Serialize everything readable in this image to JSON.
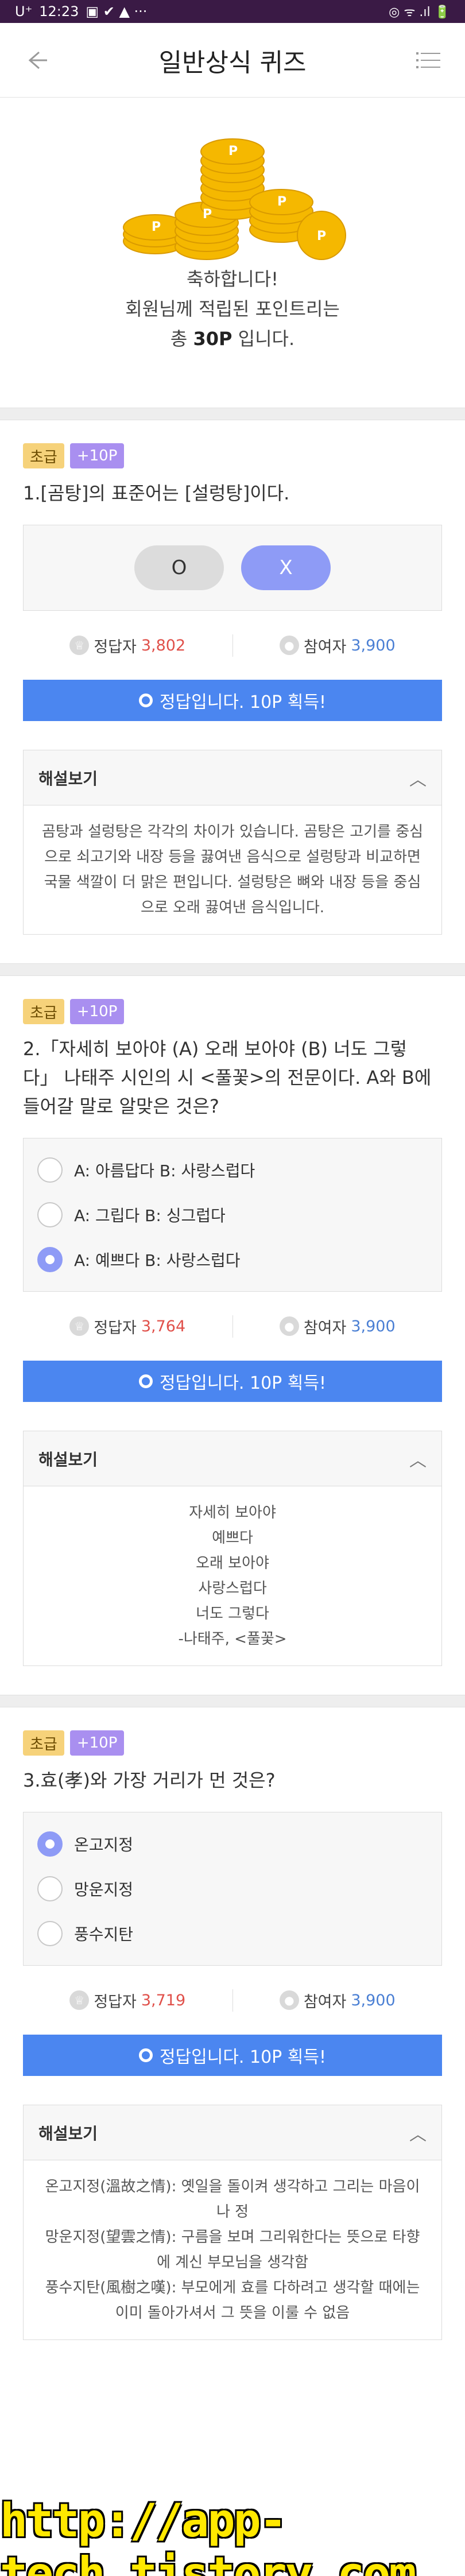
{
  "statusbar": {
    "carrier": "U⁺",
    "time": "12:23",
    "indicators": "▣ ✔ ▲ ···",
    "right": "◎ ᯤ .ıl 🔋"
  },
  "header": {
    "title": "일반상식 퀴즈",
    "back_icon": "arrow-left-icon",
    "menu_icon": "menu-icon"
  },
  "hero": {
    "line1": "축하합니다!",
    "line2": "회원님께 적립된 포인트리는",
    "line3_pre": "총 ",
    "line3_points": "30P",
    "line3_post": " 입니다."
  },
  "labels": {
    "correct": "정답자",
    "participants": "참여자",
    "explain": "해설보기",
    "result": "정답입니다. 10P 획득!"
  },
  "colors": {
    "accent": "#4b86f0",
    "selected": "#8e9bf6",
    "level_badge": "#f6d27a",
    "point_badge": "#a98ff0"
  },
  "quizzes": [
    {
      "level": "초급",
      "points": "+10P",
      "question": "1.[곰탕]의 표준어는 [설렁탕]이다.",
      "o": "O",
      "x": "X",
      "correct_count": "3,802",
      "participant_count": "3,900",
      "explanation": "곰탕과 설렁탕은 각각의 차이가 있습니다. 곰탕은 고기를 중심으로 쇠고기와 내장 등을 끓여낸 음식으로 설렁탕과 비교하면 국물 색깔이 더 맑은 편입니다. 설렁탕은 뼈와 내장 등을 중심으로 오래 끓여낸 음식입니다."
    },
    {
      "level": "초급",
      "points": "+10P",
      "question": "2.「자세히 보아야 (A) 오래 보아야 (B) 너도 그렇다」 나태주 시인의 시 <풀꽃>의 전문이다. A와 B에 들어갈 말로 알맞은 것은?",
      "options": [
        "A: 아름답다 B: 사랑스럽다",
        "A: 그립다 B: 싱그럽다",
        "A: 예쁘다 B: 사랑스럽다"
      ],
      "selected": 2,
      "correct_count": "3,764",
      "participant_count": "3,900",
      "explanation_lines": [
        "자세히 보아야",
        "예쁘다",
        "오래 보아야",
        "사랑스럽다",
        "너도 그렇다",
        "-나태주, <풀꽃>"
      ]
    },
    {
      "level": "초급",
      "points": "+10P",
      "question": "3.효(孝)와 가장 거리가 먼 것은?",
      "options": [
        "온고지정",
        "망운지정",
        "풍수지탄"
      ],
      "selected": 0,
      "correct_count": "3,719",
      "participant_count": "3,900",
      "explanation_lines": [
        "온고지정(溫故之情): 옛일을 돌이켜 생각하고 그리는 마음이나 정",
        "망운지정(望雲之情): 구름을 보며 그리워한다는 뜻으로 타향에 계신 부모님을 생각함",
        "풍수지탄(風樹之嘆): 부모에게 효를 다하려고 생각할 때에는 이미 돌아가셔서 그 뜻을 이룰 수 없음"
      ]
    }
  ],
  "watermark": "http://app-tech.tistory.com"
}
